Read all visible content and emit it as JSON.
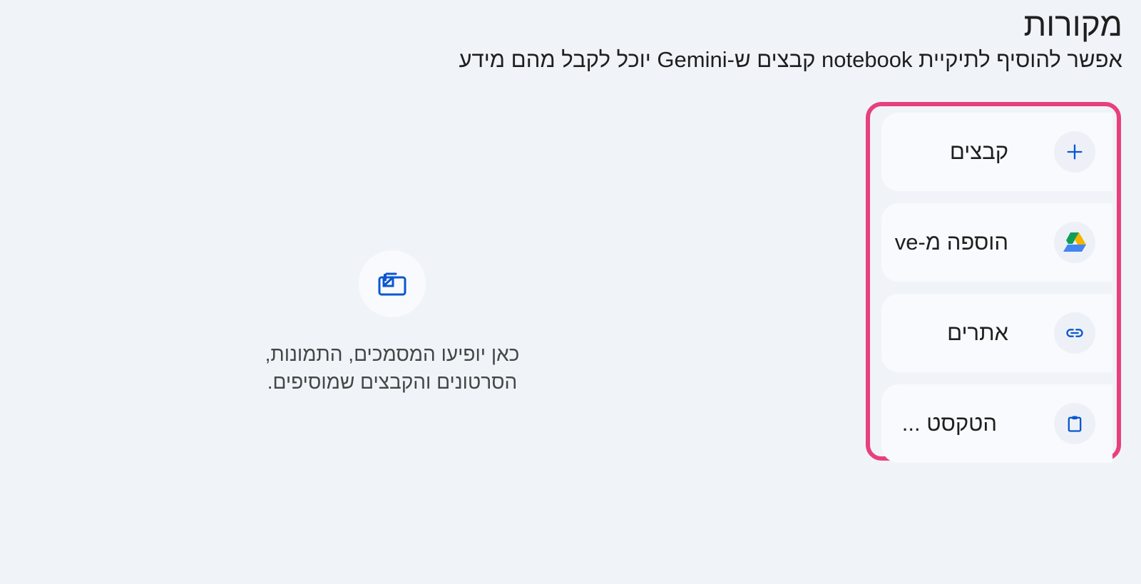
{
  "header": {
    "title": "מקורות",
    "subtitle": "אפשר להוסיף לתיקיית notebook קבצים ש-Gemini יוכל לקבל מהם מידע"
  },
  "sources_menu": {
    "items": [
      {
        "label": "קבצים",
        "icon": "plus-icon"
      },
      {
        "label": "הוספה מ-ve",
        "icon": "google-drive-icon"
      },
      {
        "label": "אתרים",
        "icon": "link-icon"
      },
      {
        "label": "הטקסט ...",
        "icon": "clipboard-icon"
      }
    ]
  },
  "empty_state": {
    "icon": "sources-stack-icon",
    "line1": "כאן יופיעו המסמכים, התמונות,",
    "line2": "הסרטונים והקבצים שמוסיפים."
  },
  "colors": {
    "background": "#f0f4f9",
    "highlight_border": "#e8407c",
    "accent_blue": "#0b57d0",
    "item_background": "#f8fafd"
  }
}
